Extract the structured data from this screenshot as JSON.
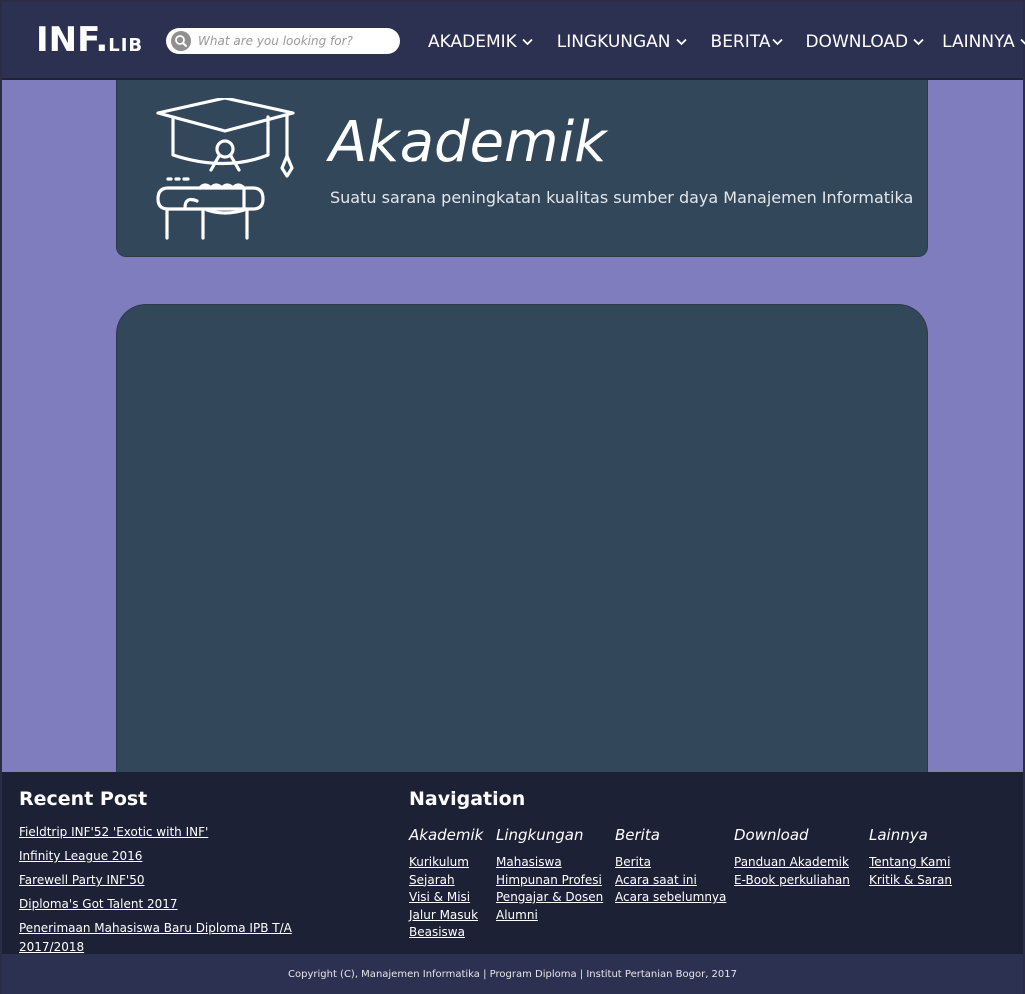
{
  "header": {
    "logo_main": "INF.",
    "logo_sub": "LIB",
    "search_placeholder": "What are you looking for?",
    "nav": [
      {
        "label": "AKADEMIK"
      },
      {
        "label": "LINGKUNGAN"
      },
      {
        "label": "BERITA"
      },
      {
        "label": "DOWNLOAD"
      },
      {
        "label": "LAINNYA"
      }
    ]
  },
  "hero": {
    "icon": "graduation-cap-diploma-icon",
    "title": "Akademik",
    "subtitle": "Suatu sarana peningkatan kualitas sumber daya Manajemen Informatika"
  },
  "footer": {
    "recent_title": "Recent Post",
    "recent_posts": [
      "Fieldtrip INF'52 'Exotic with INF'",
      "Infinity League 2016",
      "Farewell Party INF'50",
      "Diploma's Got Talent 2017",
      "Penerimaan Mahasiswa Baru Diploma IPB T/A 2017/2018"
    ],
    "nav_title": "Navigation",
    "columns": [
      {
        "title": "Akademik",
        "links": [
          "Kurikulum",
          "Sejarah",
          "Visi & Misi",
          "Jalur Masuk",
          "Beasiswa"
        ]
      },
      {
        "title": "Lingkungan",
        "links": [
          "Mahasiswa",
          "Himpunan Profesi",
          "Pengajar & Dosen",
          "Alumni"
        ]
      },
      {
        "title": "Berita",
        "links": [
          "Berita",
          "Acara saat ini",
          "Acara sebelumnya"
        ]
      },
      {
        "title": "Download",
        "links": [
          "Panduan Akademik",
          "E-Book perkuliahan"
        ]
      },
      {
        "title": "Lainnya",
        "links": [
          "Tentang Kami",
          "Kritik & Saran"
        ]
      }
    ],
    "copyright": "Copyright (C), Manajemen Informatika | Program Diploma | Institut Pertanian Bogor, 2017"
  },
  "colors": {
    "page_bg": "#807dbf",
    "header_bg": "#2c3152",
    "card_bg": "#33475b",
    "footer_bg": "#1d2135"
  }
}
